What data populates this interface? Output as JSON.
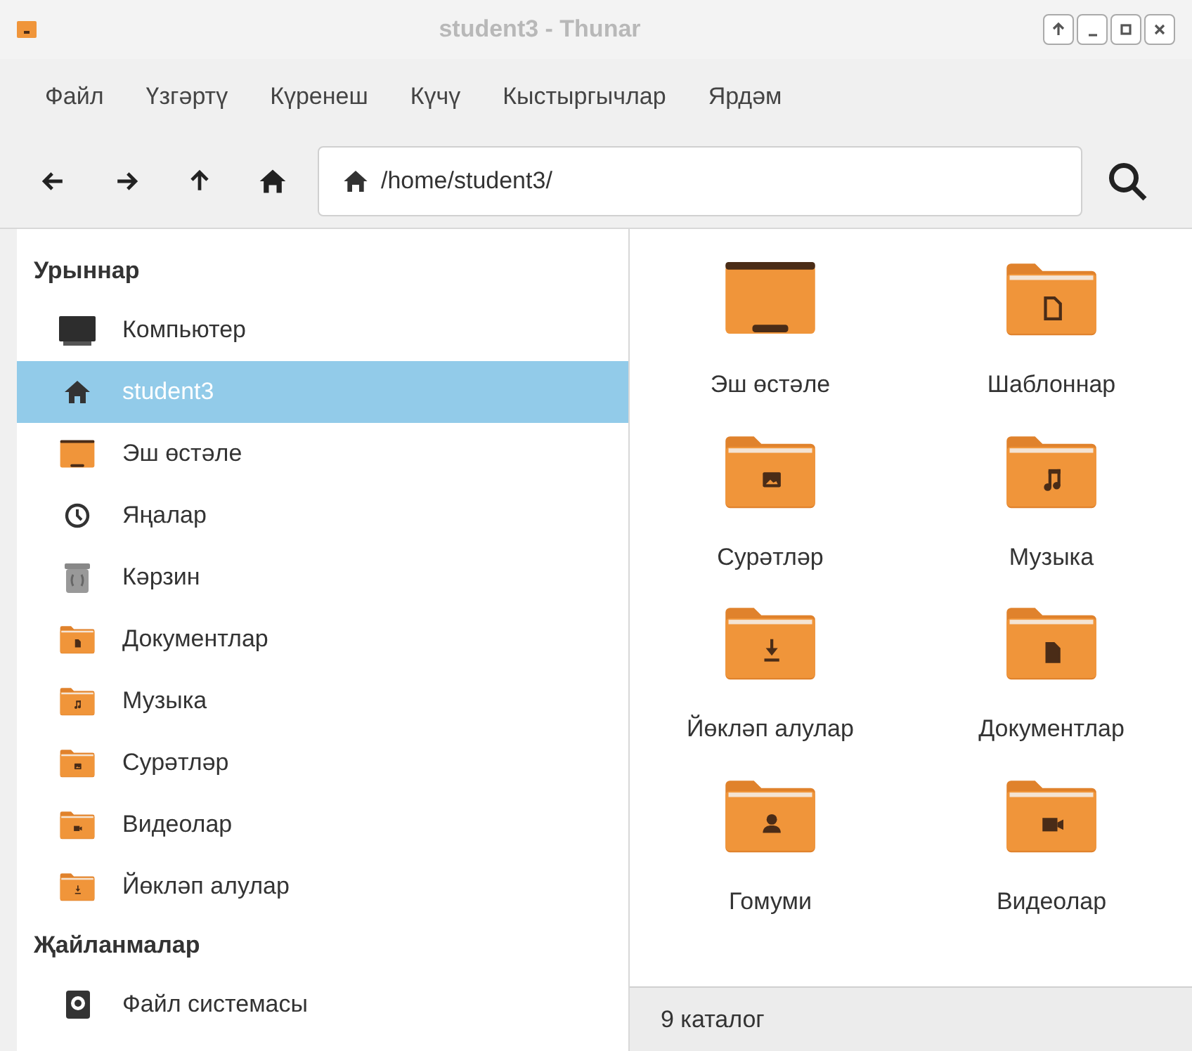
{
  "window": {
    "title": "student3 - Thunar"
  },
  "menu": [
    "Файл",
    "Үзгәртү",
    "Күренеш",
    "Күчү",
    "Кыстыргычлар",
    "Ярдәм"
  ],
  "location": {
    "path": "/home/student3/"
  },
  "sidebar": {
    "sections": [
      {
        "title": "Урыннар",
        "items": [
          {
            "label": "Компьютер",
            "kind": "computer",
            "selected": false
          },
          {
            "label": "student3",
            "kind": "home",
            "selected": true
          },
          {
            "label": "Эш өстәле",
            "kind": "desktop",
            "selected": false
          },
          {
            "label": "Яңалар",
            "kind": "recent",
            "selected": false
          },
          {
            "label": "Кәрзин",
            "kind": "trash",
            "selected": false
          },
          {
            "label": "Документлар",
            "kind": "documents",
            "selected": false
          },
          {
            "label": "Музыка",
            "kind": "music",
            "selected": false
          },
          {
            "label": "Сурәтләр",
            "kind": "pictures",
            "selected": false
          },
          {
            "label": "Видеолар",
            "kind": "videos",
            "selected": false
          },
          {
            "label": "Йөкләп алулар",
            "kind": "downloads",
            "selected": false
          }
        ]
      },
      {
        "title": "Җайланмалар",
        "items": [
          {
            "label": "Файл системасы",
            "kind": "drive",
            "selected": false
          }
        ]
      }
    ]
  },
  "files": [
    {
      "name": "Эш өстәле",
      "kind": "desktop"
    },
    {
      "name": "Шаблоннар",
      "kind": "templates"
    },
    {
      "name": "Сурәтләр",
      "kind": "pictures"
    },
    {
      "name": "Музыка",
      "kind": "music"
    },
    {
      "name": "Йөкләп алулар",
      "kind": "downloads"
    },
    {
      "name": "Документлар",
      "kind": "documents"
    },
    {
      "name": "Гомуми",
      "kind": "public"
    },
    {
      "name": "Видеолар",
      "kind": "videos"
    }
  ],
  "status_bar": "9 каталог"
}
